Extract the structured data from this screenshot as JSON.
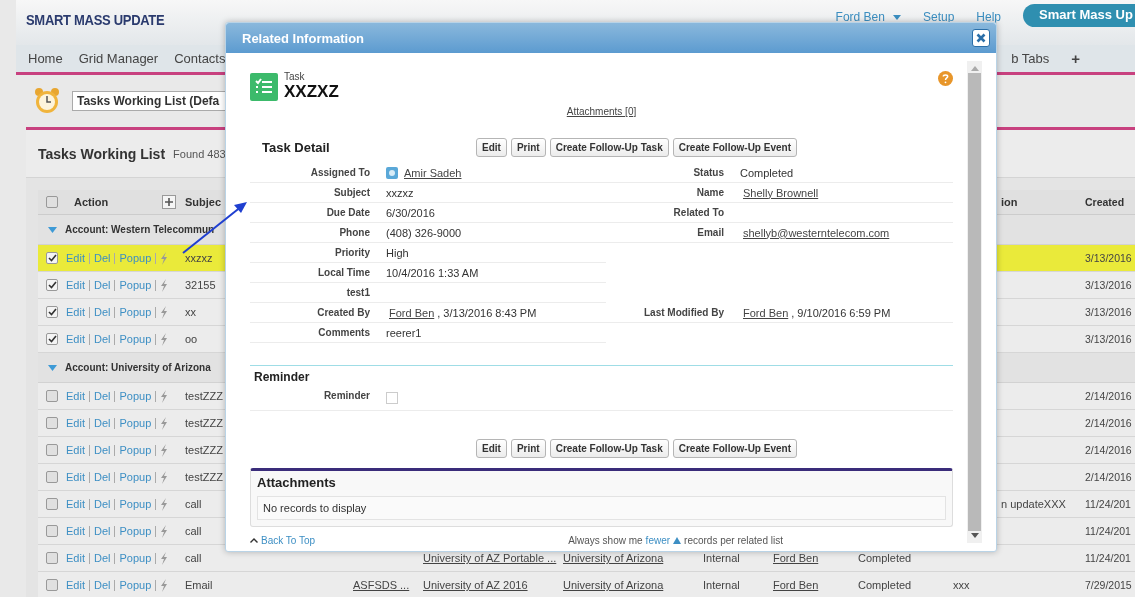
{
  "header": {
    "logo": "SMART MASS UPDATE",
    "user_menu": "Ford Ben",
    "links": [
      "Setup",
      "Help"
    ],
    "app_button": "Smart Mass Up"
  },
  "nav": {
    "tabs": [
      "Home",
      "Grid Manager",
      "Contacts"
    ],
    "more_tabs": "b Tabs",
    "add_tab": "+"
  },
  "list_view": {
    "select": "Tasks Working List (Defa"
  },
  "list_panel": {
    "title": "Tasks Working List",
    "count": "Found 483"
  },
  "table": {
    "header_checked": false,
    "columns": {
      "action": "Action",
      "subject": "Subjec",
      "column_10": "ion",
      "created": "Created"
    },
    "groups": [
      {
        "label": "Account: Western Telecommun",
        "expanded": true,
        "rows": [
          {
            "checked": true,
            "selected": true,
            "actions": [
              "Edit",
              "Del",
              "Popup"
            ],
            "subject": "xxzxz",
            "created": "3/13/2016"
          },
          {
            "checked": true,
            "selected": false,
            "actions": [
              "Edit",
              "Del",
              "Popup"
            ],
            "subject": "32155",
            "created": "3/13/2016"
          },
          {
            "checked": true,
            "selected": false,
            "actions": [
              "Edit",
              "Del",
              "Popup"
            ],
            "subject": "xx",
            "created": "3/13/2016"
          },
          {
            "checked": true,
            "selected": false,
            "actions": [
              "Edit",
              "Del",
              "Popup"
            ],
            "subject": "oo",
            "created": "3/13/2016"
          }
        ]
      },
      {
        "label": "Account: University of Arizona",
        "expanded": true,
        "rows": [
          {
            "checked": false,
            "selected": false,
            "actions": [
              "Edit",
              "Del",
              "Popup"
            ],
            "subject": "testZZZ",
            "created": "2/14/2016"
          },
          {
            "checked": false,
            "selected": false,
            "actions": [
              "Edit",
              "Del",
              "Popup"
            ],
            "subject": "testZZZ",
            "created": "2/14/2016"
          },
          {
            "checked": false,
            "selected": false,
            "actions": [
              "Edit",
              "Del",
              "Popup"
            ],
            "subject": "testZZZ",
            "created": "2/14/2016"
          },
          {
            "checked": false,
            "selected": false,
            "actions": [
              "Edit",
              "Del",
              "Popup"
            ],
            "subject": "testZZZ",
            "created": "2/14/2016"
          },
          {
            "checked": false,
            "selected": false,
            "actions": [
              "Edit",
              "Del",
              "Popup"
            ],
            "subject": "call",
            "column_10": "n updateXXX",
            "created": "11/24/201"
          },
          {
            "checked": false,
            "selected": false,
            "actions": [
              "Edit",
              "Del",
              "Popup"
            ],
            "subject": "call",
            "created": "11/24/201"
          },
          {
            "checked": false,
            "selected": false,
            "actions": [
              "Edit",
              "Del",
              "Popup"
            ],
            "subject": "call",
            "column_5": "University of AZ Portable ...",
            "column_6": "University of Arizona",
            "column_7": "Internal",
            "column_8": "Ford Ben",
            "column_9": "Completed",
            "created": "11/24/201"
          },
          {
            "checked": false,
            "selected": false,
            "actions": [
              "Edit",
              "Del",
              "Popup"
            ],
            "subject": "Email",
            "column_4": "ASFSDS ...",
            "column_5": "University of AZ 2016",
            "column_6": "University of Arizona",
            "column_7": "Internal",
            "column_8": "Ford Ben",
            "column_9": "Completed",
            "column_10": "xxx",
            "created": "7/29/2015"
          }
        ]
      }
    ]
  },
  "modal": {
    "title": "Related Information",
    "record": {
      "type": "Task",
      "name": "XXZXZ"
    },
    "attachments_link": "Attachments [0]",
    "detail": {
      "title": "Task Detail",
      "buttons": [
        "Edit",
        "Print",
        "Create Follow-Up Task",
        "Create Follow-Up Event"
      ],
      "rows": [
        [
          {
            "label": "Assigned To",
            "kind": "user",
            "link": "Amir Sadeh"
          },
          {
            "label": "Status",
            "kind": "text",
            "value": "Completed"
          }
        ],
        [
          {
            "label": "Subject",
            "kind": "text",
            "value": "xxzxz"
          },
          {
            "label": "Name",
            "kind": "link",
            "link": "Shelly Brownell"
          }
        ],
        [
          {
            "label": "Due Date",
            "kind": "text",
            "value": "6/30/2016"
          },
          {
            "label": "Related To",
            "kind": "empty"
          }
        ],
        [
          {
            "label": "Phone",
            "kind": "text",
            "value": "(408) 326-9000"
          },
          {
            "label": "Email",
            "kind": "link",
            "link": "shellyb@westerntelecom.com"
          }
        ],
        [
          {
            "label": "Priority",
            "kind": "text",
            "value": "High"
          }
        ],
        [
          {
            "label": "Local Time",
            "kind": "text",
            "value": "10/4/2016 1:33 AM"
          }
        ],
        [
          {
            "label": "test1",
            "kind": "empty"
          }
        ],
        [
          {
            "label": "Created By",
            "kind": "link",
            "link": "Ford Ben",
            "suffix": ", 3/13/2016 8:43 PM"
          },
          {
            "label": "Last Modified By",
            "kind": "link",
            "link": "Ford Ben",
            "suffix": ", 9/10/2016 6:59 PM"
          }
        ],
        [
          {
            "label": "Comments",
            "kind": "text",
            "value": "reerer1"
          }
        ]
      ]
    },
    "reminder": {
      "title": "Reminder",
      "label": "Reminder",
      "checked": false
    },
    "bottom_buttons": [
      "Edit",
      "Print",
      "Create Follow-Up Task",
      "Create Follow-Up Event"
    ],
    "attachments": {
      "title": "Attachments",
      "empty": "No records to display"
    },
    "footer": {
      "back_to_top": "Back To Top",
      "prefix": "Always show me",
      "link": "fewer",
      "suffix": "records per related list"
    }
  }
}
